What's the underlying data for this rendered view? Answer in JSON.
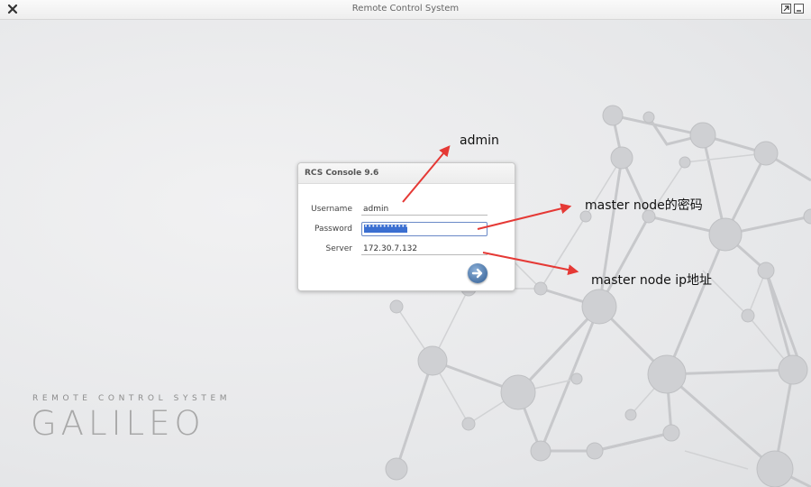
{
  "window": {
    "title": "Remote Control System",
    "close_icon": "close-x-icon",
    "maximize_icon": "restore-icon",
    "minimize_icon": "minimize-icon"
  },
  "brand": {
    "subtitle": "REMOTE CONTROL SYSTEM",
    "name": "GALILEO"
  },
  "login": {
    "title": "RCS Console 9.6",
    "username_label": "Username",
    "username_value": "admin",
    "password_label": "Password",
    "password_value": "••••••••••••",
    "server_label": "Server",
    "server_value": "172.30.7.132",
    "submit_icon": "arrow-right-icon"
  },
  "annotations": {
    "username_note": "admin",
    "password_note": "master node的密码",
    "server_note": "master node ip地址"
  },
  "colors": {
    "annotation_arrow": "#e53935",
    "selection": "#3b6fd1",
    "submit": "#2f5b91"
  }
}
